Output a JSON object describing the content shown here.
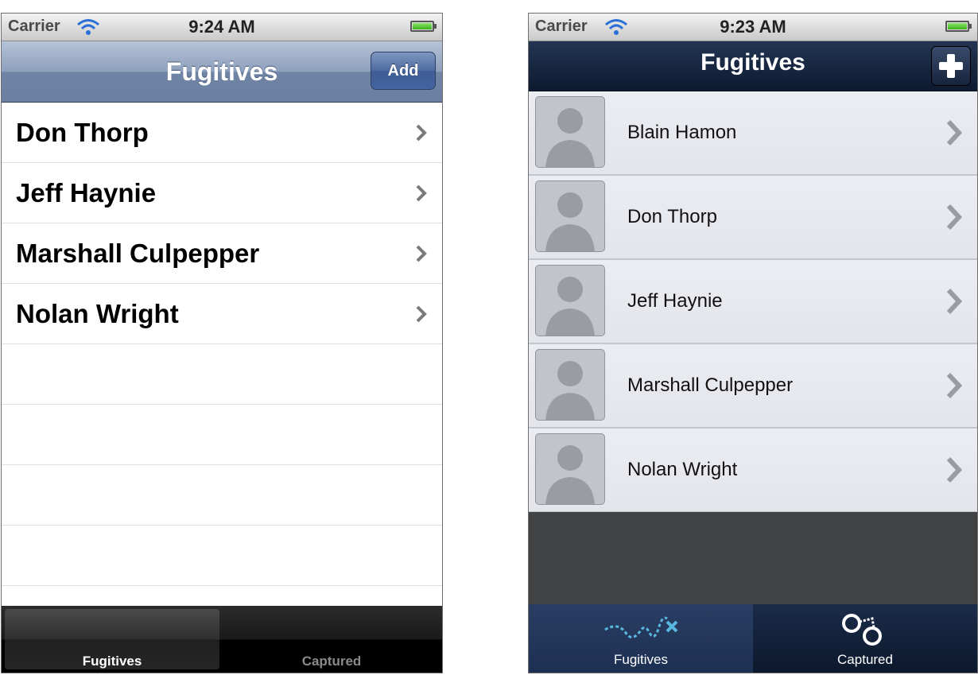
{
  "left_screen": {
    "status": {
      "carrier": "Carrier",
      "time": "9:24 AM"
    },
    "nav": {
      "title": "Fugitives",
      "add_label": "Add"
    },
    "rows": [
      "Don Thorp",
      "Jeff Haynie",
      "Marshall Culpepper",
      "Nolan Wright"
    ],
    "tabs": [
      {
        "label": "Fugitives",
        "selected": true
      },
      {
        "label": "Captured",
        "selected": false
      }
    ]
  },
  "right_screen": {
    "status": {
      "carrier": "Carrier",
      "time": "9:23 AM"
    },
    "nav": {
      "title": "Fugitives",
      "add_icon": "plus-icon"
    },
    "rows": [
      "Blain Hamon",
      "Don Thorp",
      "Jeff Haynie",
      "Marshall Culpepper",
      "Nolan Wright"
    ],
    "tabs": [
      {
        "label": "Fugitives",
        "icon": "trail-icon",
        "selected": true
      },
      {
        "label": "Captured",
        "icon": "handcuffs-icon",
        "selected": false
      }
    ]
  }
}
